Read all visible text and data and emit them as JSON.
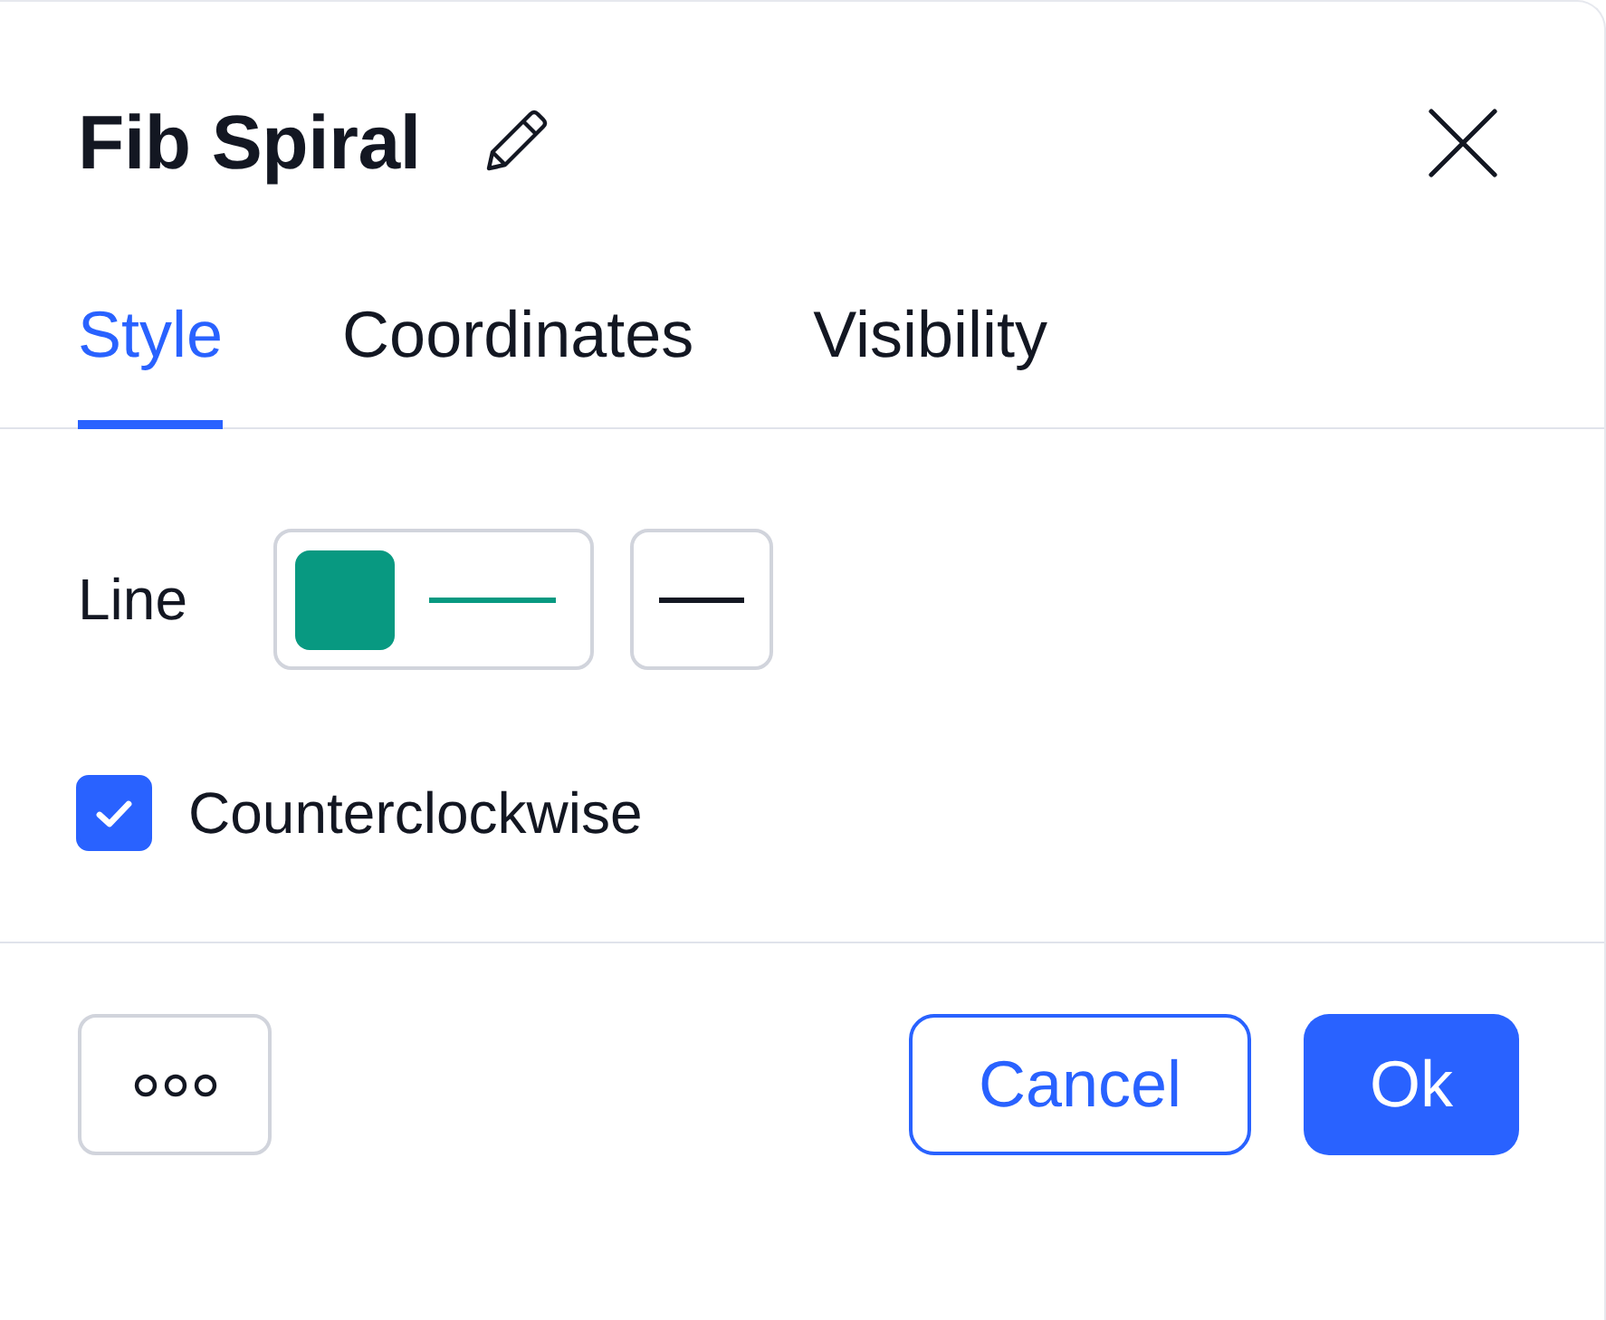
{
  "dialog": {
    "title": "Fib Spiral",
    "tabs": [
      {
        "label": "Style",
        "selected": true
      },
      {
        "label": "Coordinates",
        "selected": false
      },
      {
        "label": "Visibility",
        "selected": false
      }
    ],
    "rows": [
      {
        "kind": "line",
        "label": "Line",
        "color": "#089981"
      },
      {
        "kind": "checkbox",
        "label": "Counterclockwise",
        "checked": true
      }
    ],
    "buttons": [
      {
        "kind": "more"
      },
      {
        "kind": "secondary",
        "label": "Cancel"
      },
      {
        "kind": "primary",
        "label": "Ok"
      }
    ]
  }
}
